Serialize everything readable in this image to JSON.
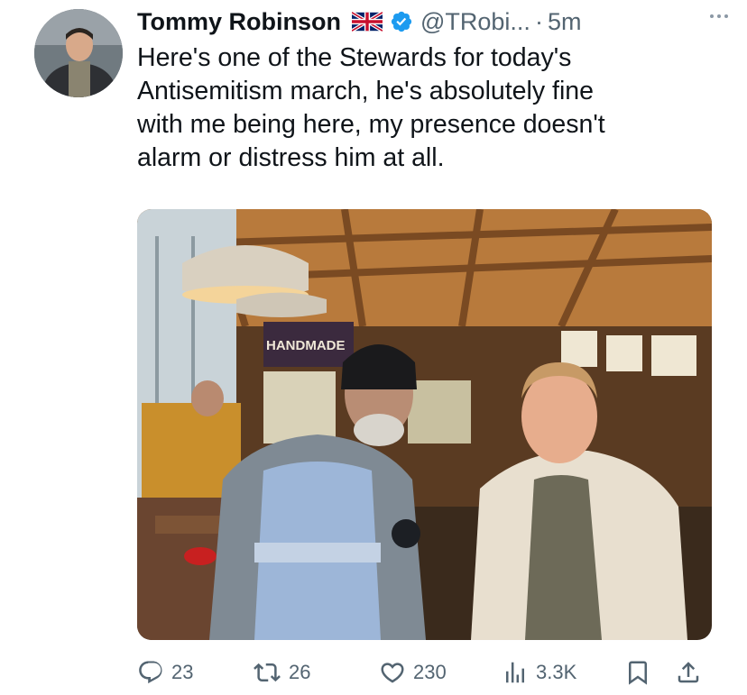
{
  "author": {
    "name": "Tommy Robinson",
    "handle": "@TRobi...",
    "separator": "·",
    "time": "5m"
  },
  "tweet": {
    "text_lines": [
      "Here's one of the Stewards for today's",
      "Antisemitism march, he's absolutely fine",
      "with me being here, my presence doesn't",
      "alarm or distress him at all."
    ]
  },
  "media": {
    "sign_text": "HANDMADE"
  },
  "actions": {
    "replies": "23",
    "reposts": "26",
    "likes": "230",
    "views": "3.3K"
  },
  "icons": {
    "flag": "uk-flag-icon",
    "verified": "verified-badge-icon",
    "more": "more-options-icon",
    "reply": "reply-icon",
    "repost": "repost-icon",
    "like": "heart-icon",
    "views": "analytics-icon",
    "bookmark": "bookmark-icon",
    "share": "share-icon"
  },
  "colors": {
    "verified": "#1d9bf0",
    "text": "#0f1419",
    "secondary": "#536471"
  }
}
